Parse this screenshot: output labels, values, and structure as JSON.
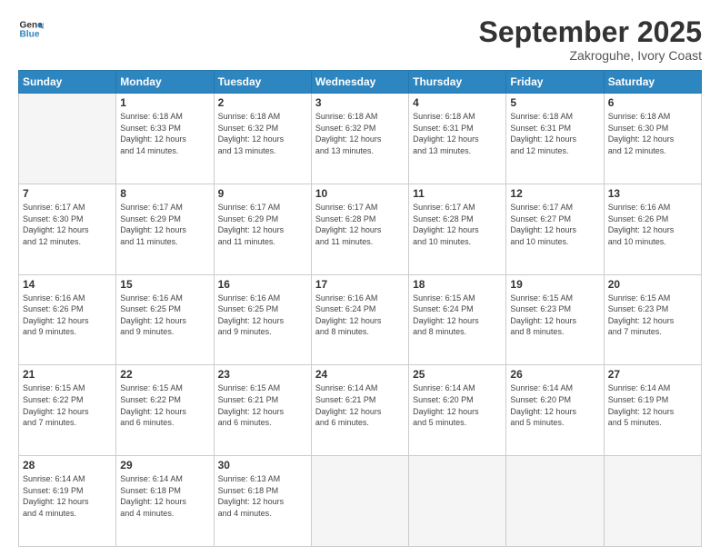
{
  "header": {
    "logo_general": "General",
    "logo_blue": "Blue",
    "month": "September 2025",
    "location": "Zakroguhe, Ivory Coast"
  },
  "weekdays": [
    "Sunday",
    "Monday",
    "Tuesday",
    "Wednesday",
    "Thursday",
    "Friday",
    "Saturday"
  ],
  "weeks": [
    [
      {
        "day": "",
        "info": ""
      },
      {
        "day": "1",
        "info": "Sunrise: 6:18 AM\nSunset: 6:33 PM\nDaylight: 12 hours\nand 14 minutes."
      },
      {
        "day": "2",
        "info": "Sunrise: 6:18 AM\nSunset: 6:32 PM\nDaylight: 12 hours\nand 13 minutes."
      },
      {
        "day": "3",
        "info": "Sunrise: 6:18 AM\nSunset: 6:32 PM\nDaylight: 12 hours\nand 13 minutes."
      },
      {
        "day": "4",
        "info": "Sunrise: 6:18 AM\nSunset: 6:31 PM\nDaylight: 12 hours\nand 13 minutes."
      },
      {
        "day": "5",
        "info": "Sunrise: 6:18 AM\nSunset: 6:31 PM\nDaylight: 12 hours\nand 12 minutes."
      },
      {
        "day": "6",
        "info": "Sunrise: 6:18 AM\nSunset: 6:30 PM\nDaylight: 12 hours\nand 12 minutes."
      }
    ],
    [
      {
        "day": "7",
        "info": "Sunrise: 6:17 AM\nSunset: 6:30 PM\nDaylight: 12 hours\nand 12 minutes."
      },
      {
        "day": "8",
        "info": "Sunrise: 6:17 AM\nSunset: 6:29 PM\nDaylight: 12 hours\nand 11 minutes."
      },
      {
        "day": "9",
        "info": "Sunrise: 6:17 AM\nSunset: 6:29 PM\nDaylight: 12 hours\nand 11 minutes."
      },
      {
        "day": "10",
        "info": "Sunrise: 6:17 AM\nSunset: 6:28 PM\nDaylight: 12 hours\nand 11 minutes."
      },
      {
        "day": "11",
        "info": "Sunrise: 6:17 AM\nSunset: 6:28 PM\nDaylight: 12 hours\nand 10 minutes."
      },
      {
        "day": "12",
        "info": "Sunrise: 6:17 AM\nSunset: 6:27 PM\nDaylight: 12 hours\nand 10 minutes."
      },
      {
        "day": "13",
        "info": "Sunrise: 6:16 AM\nSunset: 6:26 PM\nDaylight: 12 hours\nand 10 minutes."
      }
    ],
    [
      {
        "day": "14",
        "info": "Sunrise: 6:16 AM\nSunset: 6:26 PM\nDaylight: 12 hours\nand 9 minutes."
      },
      {
        "day": "15",
        "info": "Sunrise: 6:16 AM\nSunset: 6:25 PM\nDaylight: 12 hours\nand 9 minutes."
      },
      {
        "day": "16",
        "info": "Sunrise: 6:16 AM\nSunset: 6:25 PM\nDaylight: 12 hours\nand 9 minutes."
      },
      {
        "day": "17",
        "info": "Sunrise: 6:16 AM\nSunset: 6:24 PM\nDaylight: 12 hours\nand 8 minutes."
      },
      {
        "day": "18",
        "info": "Sunrise: 6:15 AM\nSunset: 6:24 PM\nDaylight: 12 hours\nand 8 minutes."
      },
      {
        "day": "19",
        "info": "Sunrise: 6:15 AM\nSunset: 6:23 PM\nDaylight: 12 hours\nand 8 minutes."
      },
      {
        "day": "20",
        "info": "Sunrise: 6:15 AM\nSunset: 6:23 PM\nDaylight: 12 hours\nand 7 minutes."
      }
    ],
    [
      {
        "day": "21",
        "info": "Sunrise: 6:15 AM\nSunset: 6:22 PM\nDaylight: 12 hours\nand 7 minutes."
      },
      {
        "day": "22",
        "info": "Sunrise: 6:15 AM\nSunset: 6:22 PM\nDaylight: 12 hours\nand 6 minutes."
      },
      {
        "day": "23",
        "info": "Sunrise: 6:15 AM\nSunset: 6:21 PM\nDaylight: 12 hours\nand 6 minutes."
      },
      {
        "day": "24",
        "info": "Sunrise: 6:14 AM\nSunset: 6:21 PM\nDaylight: 12 hours\nand 6 minutes."
      },
      {
        "day": "25",
        "info": "Sunrise: 6:14 AM\nSunset: 6:20 PM\nDaylight: 12 hours\nand 5 minutes."
      },
      {
        "day": "26",
        "info": "Sunrise: 6:14 AM\nSunset: 6:20 PM\nDaylight: 12 hours\nand 5 minutes."
      },
      {
        "day": "27",
        "info": "Sunrise: 6:14 AM\nSunset: 6:19 PM\nDaylight: 12 hours\nand 5 minutes."
      }
    ],
    [
      {
        "day": "28",
        "info": "Sunrise: 6:14 AM\nSunset: 6:19 PM\nDaylight: 12 hours\nand 4 minutes."
      },
      {
        "day": "29",
        "info": "Sunrise: 6:14 AM\nSunset: 6:18 PM\nDaylight: 12 hours\nand 4 minutes."
      },
      {
        "day": "30",
        "info": "Sunrise: 6:13 AM\nSunset: 6:18 PM\nDaylight: 12 hours\nand 4 minutes."
      },
      {
        "day": "",
        "info": ""
      },
      {
        "day": "",
        "info": ""
      },
      {
        "day": "",
        "info": ""
      },
      {
        "day": "",
        "info": ""
      }
    ]
  ]
}
